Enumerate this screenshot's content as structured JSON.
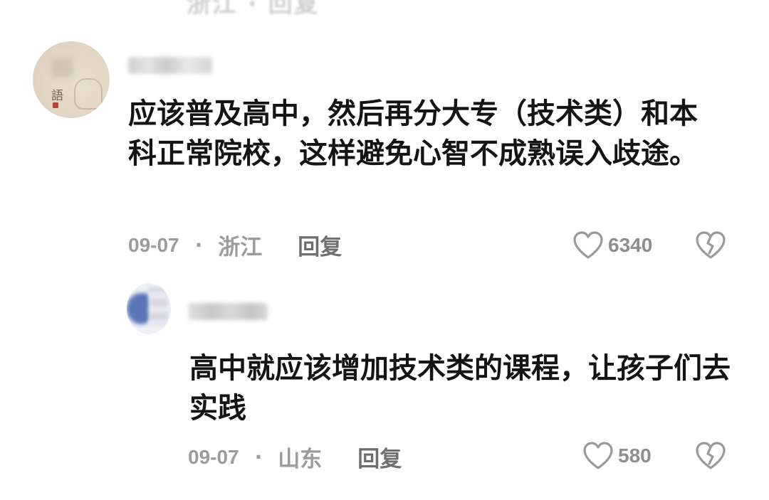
{
  "comments": [
    {
      "text": "应该普及高中，然后再分大专（技术类）和本科正常院校，这样避免心智不成熟误入歧途。",
      "date": "09-07",
      "separator": "·",
      "location": "浙江",
      "reply_label": "回复",
      "likes": "6340",
      "like_icon": "heart-outline-icon",
      "dislike_icon": "broken-heart-icon",
      "avatar_glyph": "語"
    },
    {
      "text": "高中就应该增加技术类的课程，让孩子们去实践",
      "date": "09-07",
      "separator": "·",
      "location": "山东",
      "reply_label": "回复",
      "likes": "580",
      "like_icon": "heart-outline-icon",
      "dislike_icon": "broken-heart-icon"
    }
  ],
  "top_partial": {
    "text": "浙江 · 回复"
  },
  "colors": {
    "text": "#141414",
    "meta": "#9c9c9c",
    "reply": "#6f6f6f",
    "icon": "#9a9a9a"
  }
}
